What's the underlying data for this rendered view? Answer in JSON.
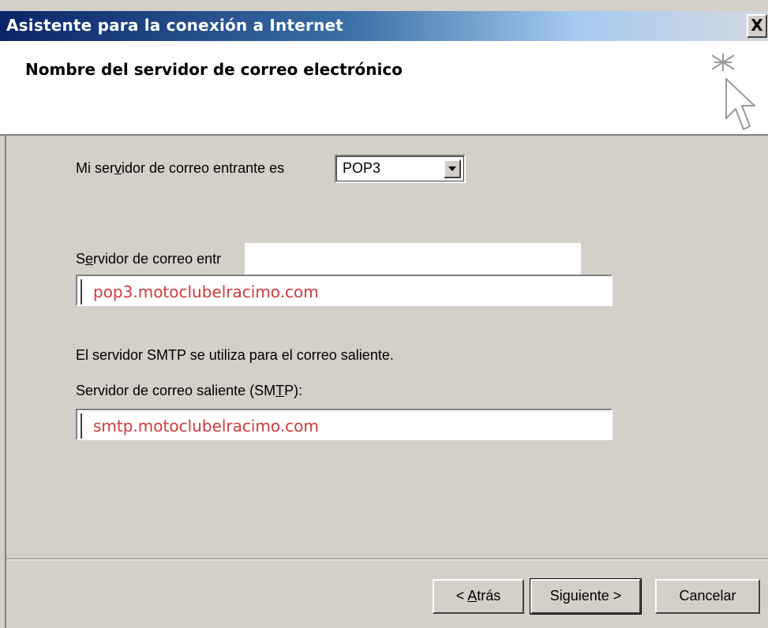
{
  "window": {
    "title": "Asistente para la conexión a Internet",
    "close_glyph": "X"
  },
  "header": {
    "title": "Nombre del servidor de correo electrónico",
    "icon": "wizard-cursor-icon"
  },
  "incoming": {
    "type_label_pre": "Mi ser",
    "type_label_accel": "v",
    "type_label_post": "idor de correo entrante es",
    "type_selected": "POP3",
    "server_label_pre": "S",
    "server_label_accel": "e",
    "server_label_post": "rvidor de correo entr",
    "server_value": "pop3.motoclubelracimo.com"
  },
  "outgoing": {
    "info_text": "El servidor SMTP se utiliza para el correo saliente.",
    "label_pre": "Servidor de correo saliente (SM",
    "label_accel": "T",
    "label_post": "P):",
    "server_value": "smtp.motoclubelracimo.com"
  },
  "buttons": {
    "back_pre": "< ",
    "back_accel": "A",
    "back_post": "trás",
    "next": "Siguiente >",
    "cancel": "Cancelar"
  }
}
